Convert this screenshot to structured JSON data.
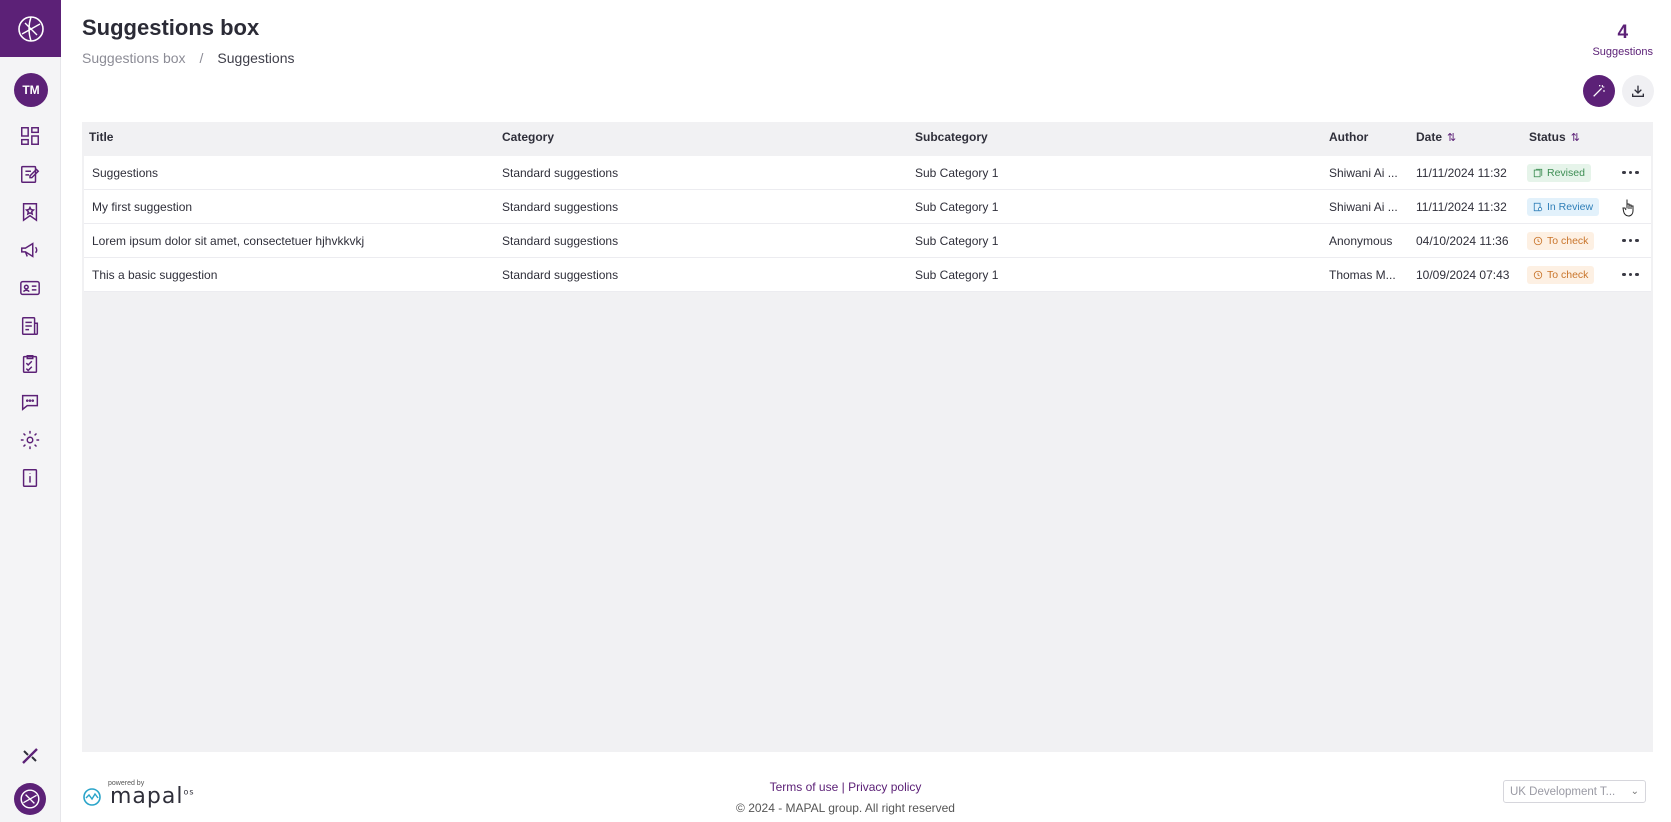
{
  "sidebar": {
    "avatar_initials": "TM",
    "nav_icons": [
      "dashboard-icon",
      "edit-form-icon",
      "bookmark-star-icon",
      "megaphone-icon",
      "id-card-icon",
      "document-icon",
      "clipboard-check-icon",
      "chat-icon",
      "gear-icon",
      "info-icon"
    ]
  },
  "header": {
    "title": "Suggestions box",
    "breadcrumb": {
      "root": "Suggestions box",
      "separator": "/",
      "current": "Suggestions"
    },
    "count": "4",
    "count_label": "Suggestions"
  },
  "table": {
    "columns": {
      "title": "Title",
      "category": "Category",
      "subcategory": "Subcategory",
      "author": "Author",
      "date": "Date",
      "status": "Status"
    },
    "rows": [
      {
        "title": "Suggestions",
        "category": "Standard suggestions",
        "subcategory": "Sub Category 1",
        "author": "Shiwani Ai ...",
        "date": "11/11/2024 11:32",
        "status": "Revised"
      },
      {
        "title": "My first suggestion",
        "category": "Standard suggestions",
        "subcategory": "Sub Category 1",
        "author": "Shiwani Ai ...",
        "date": "11/11/2024 11:32",
        "status": "In Review"
      },
      {
        "title": "Lorem ipsum dolor sit amet, consectetuer hjhvkkvkj",
        "category": "Standard suggestions",
        "subcategory": "Sub Category 1",
        "author": "Anonymous",
        "date": "04/10/2024 11:36",
        "status": "To check"
      },
      {
        "title": "This a basic suggestion",
        "category": "Standard suggestions",
        "subcategory": "Sub Category 1",
        "author": "Thomas M...",
        "date": "10/09/2024 07:43",
        "status": "To check"
      }
    ]
  },
  "footer": {
    "powered_by": "powered by",
    "brand": "mapal",
    "brand_suffix": "os",
    "terms": "Terms of use",
    "link_separator": "|",
    "privacy": "Privacy policy",
    "copyright": "© 2024 - MAPAL group. All right reserved",
    "region": "UK Development T..."
  },
  "colors": {
    "brand_purple": "#5c2177",
    "revised_bg": "#e6f4ea",
    "revised_fg": "#3e8e54",
    "review_bg": "#e2f1fb",
    "review_fg": "#2f7fb8",
    "check_bg": "#fdf0e3",
    "check_fg": "#c9752b"
  }
}
